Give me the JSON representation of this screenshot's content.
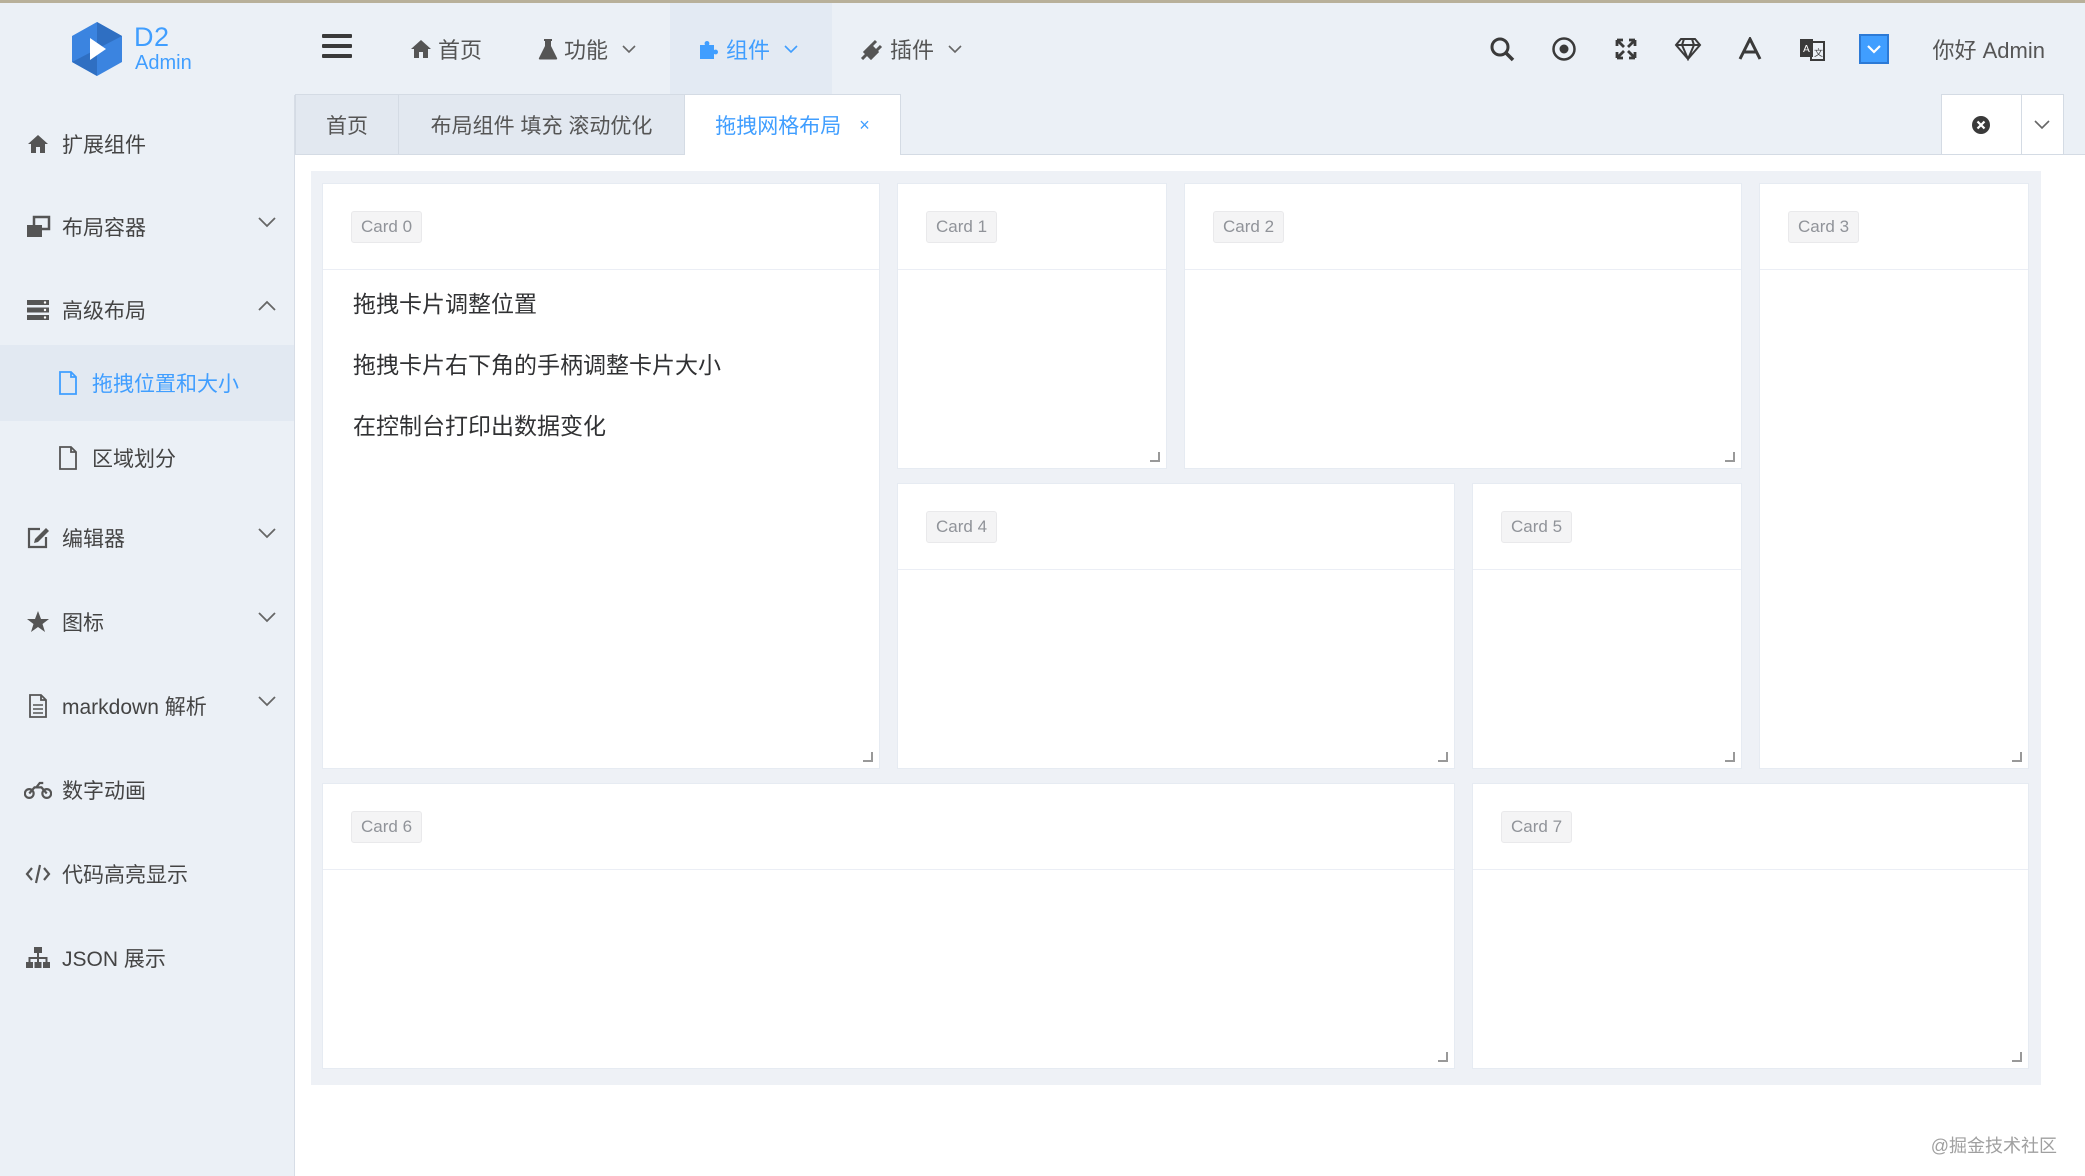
{
  "logo": {
    "line1": "D2",
    "line2": "Admin"
  },
  "header": {
    "nav": [
      {
        "label": "首页",
        "icon": "home-icon"
      },
      {
        "label": "功能",
        "icon": "flask-icon"
      },
      {
        "label": "组件",
        "icon": "puzzle-icon"
      },
      {
        "label": "插件",
        "icon": "plug-icon"
      }
    ],
    "tools": [
      "search-icon",
      "record-icon",
      "fullscreen-icon",
      "diamond-icon",
      "font-size-icon",
      "translate-icon",
      "theme-icon"
    ],
    "greeting": "你好 Admin"
  },
  "sidebar": {
    "items": [
      {
        "label": "扩展组件",
        "icon": "home-icon"
      },
      {
        "label": "布局容器",
        "icon": "window-restore-icon"
      },
      {
        "label": "高级布局",
        "icon": "server-icon"
      },
      {
        "label": "拖拽位置和大小",
        "icon": "file-icon"
      },
      {
        "label": "区域划分",
        "icon": "file-icon"
      },
      {
        "label": "编辑器",
        "icon": "edit-icon"
      },
      {
        "label": "图标",
        "icon": "star-icon"
      },
      {
        "label": "markdown 解析",
        "icon": "file-text-icon"
      },
      {
        "label": "数字动画",
        "icon": "motorcycle-icon"
      },
      {
        "label": "代码高亮显示",
        "icon": "code-icon"
      },
      {
        "label": "JSON 展示",
        "icon": "sitemap-icon"
      }
    ]
  },
  "tabs": [
    {
      "label": "首页"
    },
    {
      "label": "布局组件 填充 滚动优化"
    },
    {
      "label": "拖拽网格布局",
      "close": "×"
    }
  ],
  "cards": [
    {
      "tag": "Card 0",
      "lines": [
        "拖拽卡片调整位置",
        "拖拽卡片右下角的手柄调整卡片大小",
        "在控制台打印出数据变化"
      ]
    },
    {
      "tag": "Card 1"
    },
    {
      "tag": "Card 2"
    },
    {
      "tag": "Card 3"
    },
    {
      "tag": "Card 4"
    },
    {
      "tag": "Card 5"
    },
    {
      "tag": "Card 6"
    },
    {
      "tag": "Card 7"
    }
  ],
  "watermark": "@掘金技术社区",
  "colors": {
    "accent": "#409eff",
    "sidebar_bg": "#ebf0f6",
    "text": "#303133"
  }
}
